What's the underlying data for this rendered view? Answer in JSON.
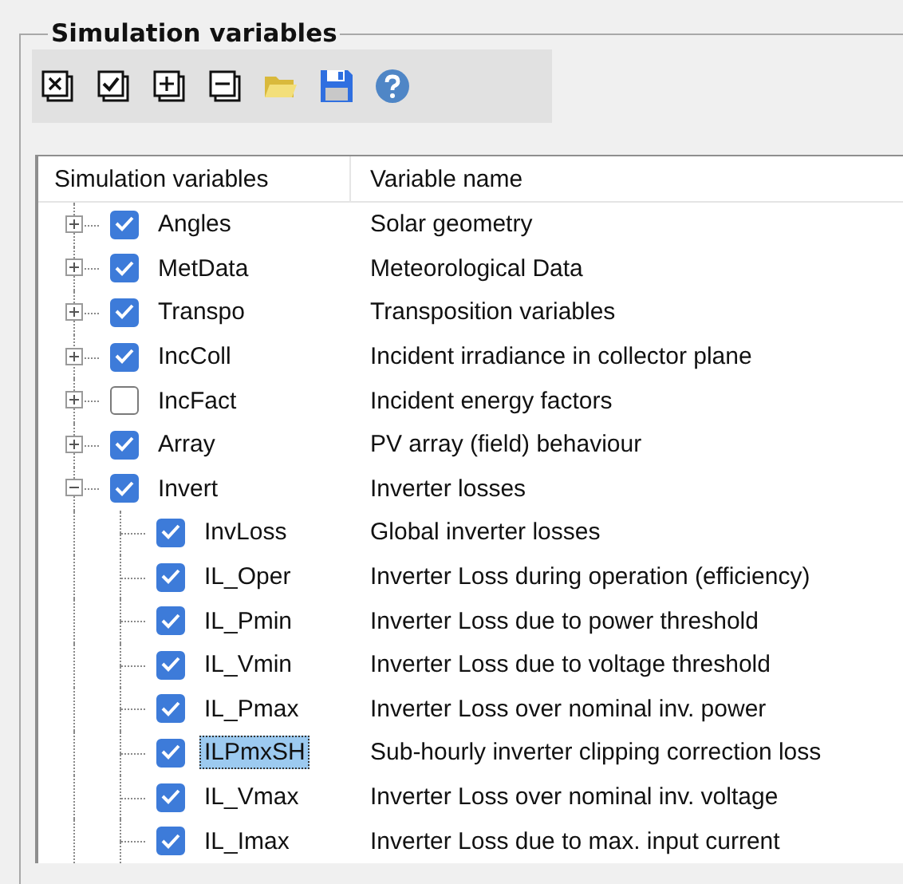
{
  "group": {
    "title": "Simulation variables"
  },
  "toolbar": [
    {
      "kind": "uncheck-all"
    },
    {
      "kind": "check-all"
    },
    {
      "kind": "expand-all"
    },
    {
      "kind": "collapse-all"
    },
    {
      "kind": "open"
    },
    {
      "kind": "save"
    },
    {
      "kind": "help"
    }
  ],
  "tree": {
    "columns": [
      "Simulation variables",
      "Variable name"
    ],
    "items": [
      {
        "name": "Angles",
        "description": "Solar geometry",
        "checked": true,
        "expanded": false,
        "selected": false
      },
      {
        "name": "MetData",
        "description": "Meteorological Data",
        "checked": true,
        "expanded": false,
        "selected": false
      },
      {
        "name": "Transpo",
        "description": "Transposition variables",
        "checked": true,
        "expanded": false,
        "selected": false
      },
      {
        "name": "IncColl",
        "description": "Incident irradiance in collector plane",
        "checked": true,
        "expanded": false,
        "selected": false
      },
      {
        "name": "IncFact",
        "description": "Incident energy factors",
        "checked": false,
        "expanded": false,
        "selected": false
      },
      {
        "name": "Array",
        "description": "PV array (field) behaviour",
        "checked": true,
        "expanded": false,
        "selected": false
      },
      {
        "name": "Invert",
        "description": "Inverter losses",
        "checked": true,
        "expanded": true,
        "selected": false,
        "children": [
          {
            "name": "InvLoss",
            "description": "Global inverter losses",
            "checked": true,
            "selected": false
          },
          {
            "name": "IL_Oper",
            "description": "Inverter Loss during operation (efficiency)",
            "checked": true,
            "selected": false
          },
          {
            "name": "IL_Pmin",
            "description": "Inverter Loss due to power threshold",
            "checked": true,
            "selected": false
          },
          {
            "name": "IL_Vmin",
            "description": "Inverter Loss due to voltage threshold",
            "checked": true,
            "selected": false
          },
          {
            "name": "IL_Pmax",
            "description": "Inverter Loss over nominal inv. power",
            "checked": true,
            "selected": false
          },
          {
            "name": "ILPmxSH",
            "description": "Sub-hourly inverter clipping correction loss",
            "checked": true,
            "selected": true
          },
          {
            "name": "IL_Vmax",
            "description": "Inverter Loss over nominal inv. voltage",
            "checked": true,
            "selected": false
          },
          {
            "name": "IL_Imax",
            "description": "Inverter Loss due to max. input current",
            "checked": true,
            "selected": false
          }
        ]
      }
    ]
  }
}
